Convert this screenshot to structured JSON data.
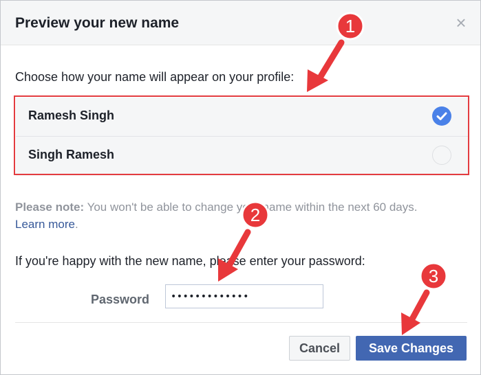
{
  "dialog": {
    "title": "Preview your new name",
    "close_glyph": "×",
    "prompt": "Choose how your name will appear on your profile:",
    "options": [
      {
        "label": "Ramesh Singh",
        "selected": true
      },
      {
        "label": "Singh Ramesh",
        "selected": false
      }
    ],
    "note": {
      "bold": "Please note:",
      "text": " You won't be able to change your name within the next 60 days.",
      "link": "Learn more",
      "period": "."
    },
    "password_prompt": "If you're happy with the new name, please enter your password:",
    "password_label": "Password",
    "password_value": "•••••••••••••",
    "cancel_label": "Cancel",
    "save_label": "Save Changes"
  },
  "annotations": [
    {
      "number": "1"
    },
    {
      "number": "2"
    },
    {
      "number": "3"
    }
  ],
  "colors": {
    "annotation_red": "#e8383b",
    "primary_blue": "#4267b2",
    "check_blue": "#4a81e8",
    "link_blue": "#365899"
  },
  "icons": {
    "close": "close-icon",
    "check": "check-icon"
  }
}
